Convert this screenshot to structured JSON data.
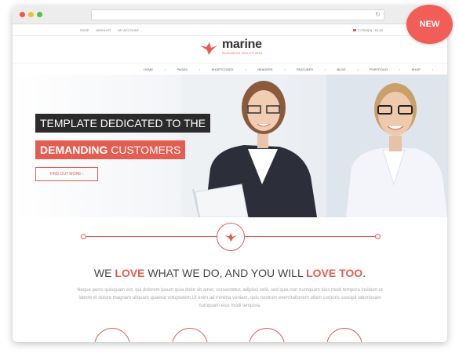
{
  "top_links": [
    "SHOP",
    "WISHLIST",
    "MY ACCOUNT"
  ],
  "cart_text": "0 ITEM(S) - £0.00",
  "logo": {
    "name": "marine",
    "tagline": "BUSINESS SOLUTIONS"
  },
  "nav": {
    "items": [
      "HOME",
      "PAGES",
      "SHORTCODES",
      "HEADERS",
      "FEATURES",
      "BLOG",
      "PORTFOLIO",
      "SHOP"
    ],
    "arrow": "›"
  },
  "hero": {
    "line1": "TEMPLATE DEDICATED TO THE",
    "line2_bold": "DEMANDING",
    "line2_rest": " CUSTOMERS",
    "cta": "FIND OUT MORE ›"
  },
  "section": {
    "h_we": "WE ",
    "h_love1": "LOVE",
    "h_mid": " WHAT WE DO, AND YOU WILL ",
    "h_love2": "LOVE TOO",
    "h_dot": ".",
    "paragraph": "Neque porro quisquam est, qui dolorem ipsum quia dolor sit amet, consectetur, adipisci velit, sed quia non numquam eius modi tempora incidunt ut labore et dolore magnam aliquam quaerat voluptatem.Ut enim ad minima veniam, quis nostrum exercitationem ullam corporis suscipit laboriosam numquam eius modi tempora."
  },
  "badge": "NEW",
  "colors": {
    "accent": "#e45d50",
    "dark": "#2b2b2b",
    "badge": "#f05e57"
  }
}
